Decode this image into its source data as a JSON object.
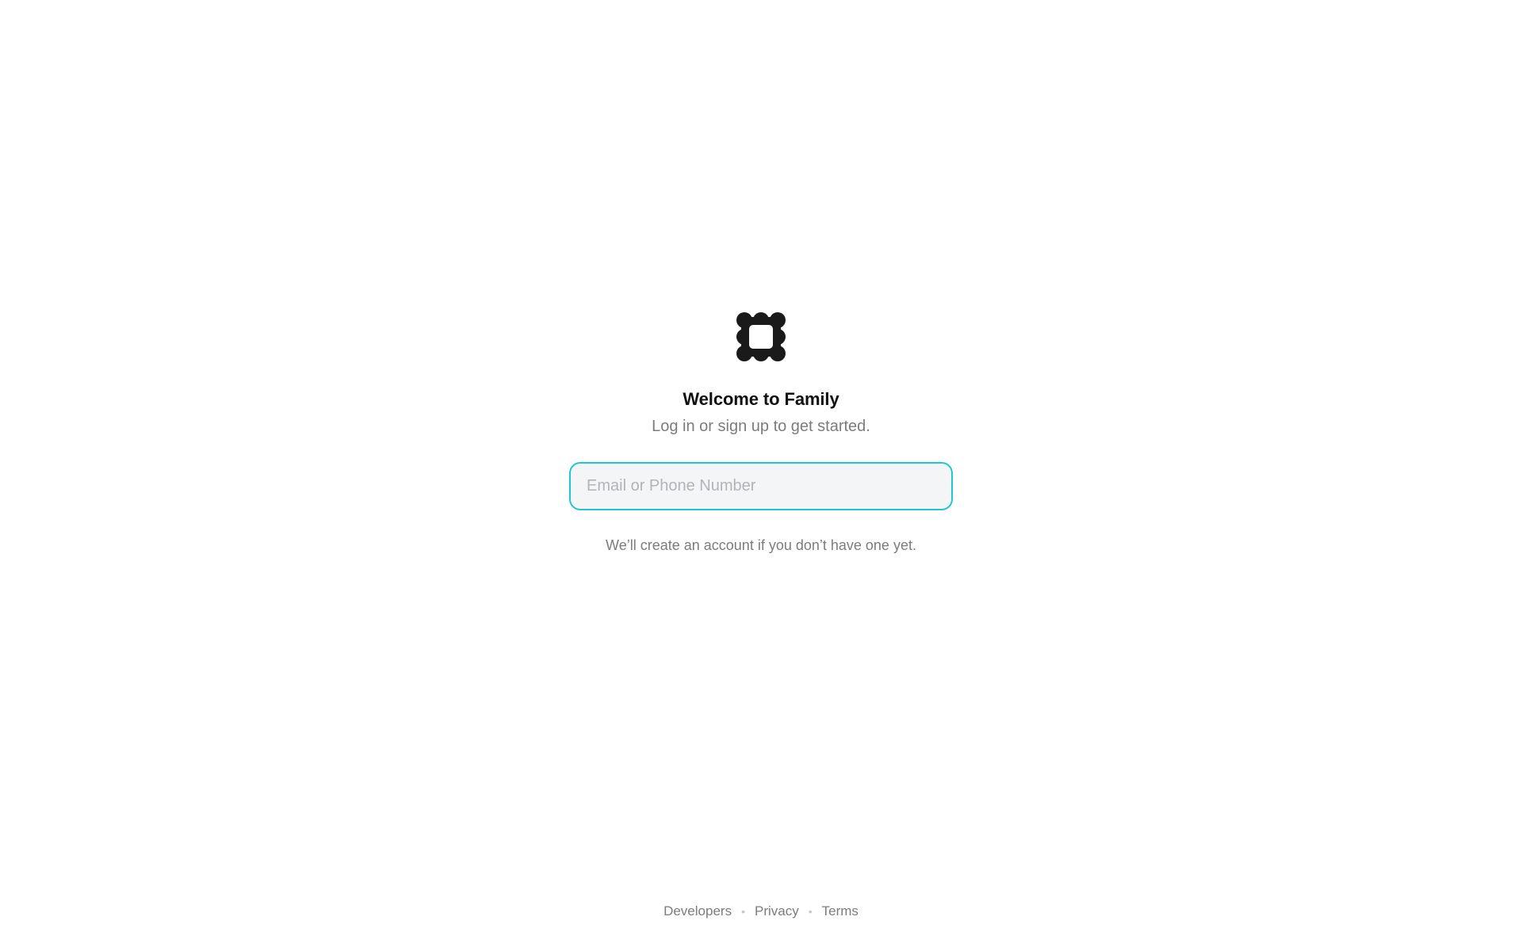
{
  "brand": {
    "logo_icon": "family-logo-icon",
    "logo_color": "#1a1a1a"
  },
  "welcome": {
    "title": "Welcome to Family",
    "subtitle": "Log in or sign up to get started."
  },
  "login": {
    "input_placeholder": "Email or Phone Number",
    "input_value": "",
    "focus_color": "#1fc7d4",
    "hint": "We’ll create an account if you don’t have one yet."
  },
  "footer": {
    "links": [
      {
        "label": "Developers"
      },
      {
        "label": "Privacy"
      },
      {
        "label": "Terms"
      }
    ],
    "separator": "•"
  }
}
